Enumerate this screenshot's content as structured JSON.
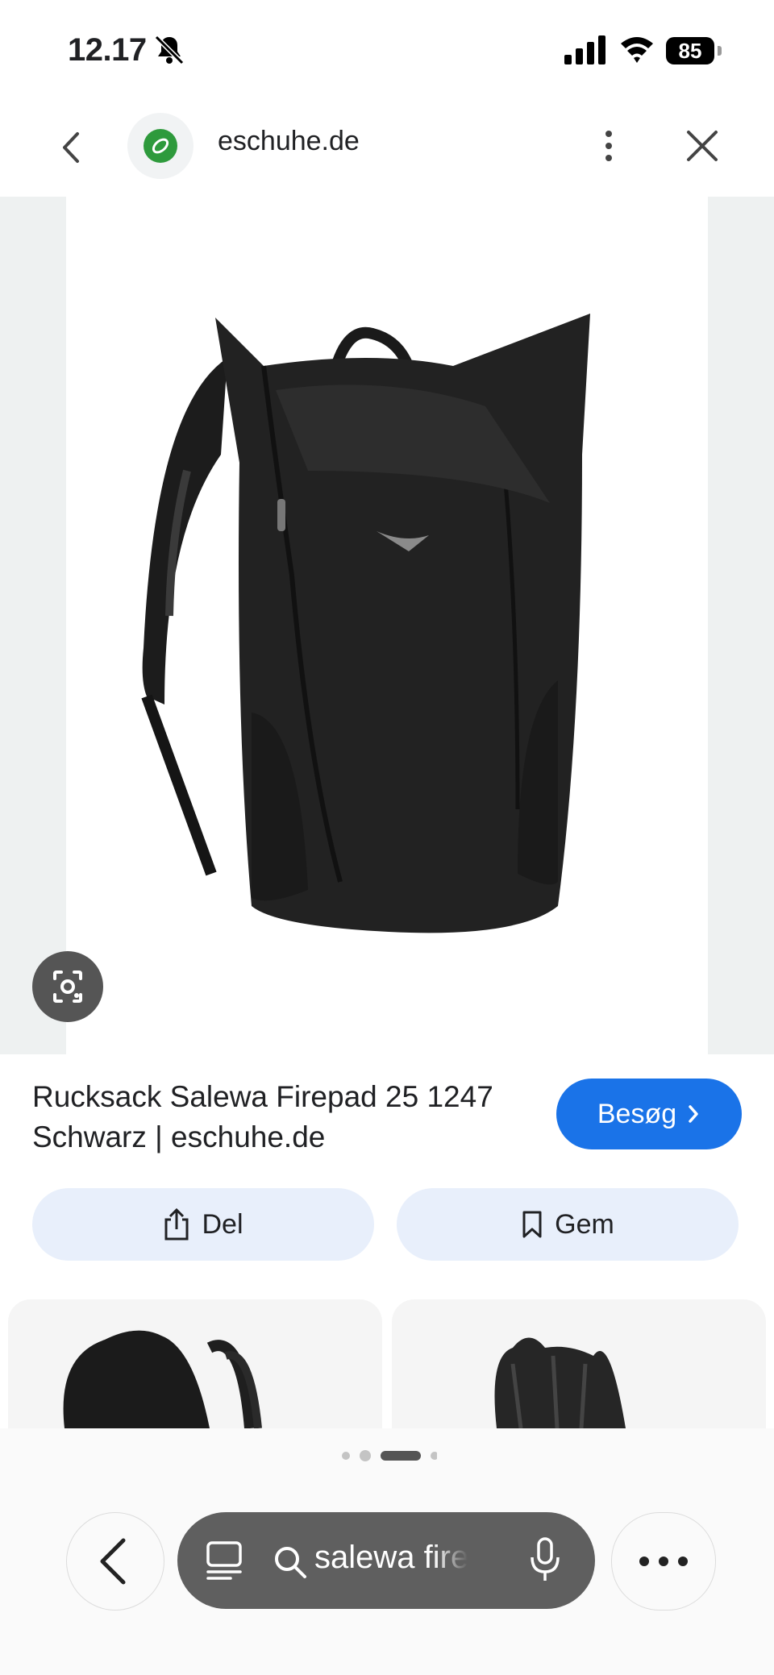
{
  "status_bar": {
    "time": "12.17",
    "battery": "85"
  },
  "header": {
    "site_name": "eschuhe.de"
  },
  "result": {
    "title": "Rucksack Salewa Firepad 25 1247 Schwarz | eschuhe.de",
    "visit_label": "Besøg",
    "share_label": "Del",
    "save_label": "Gem"
  },
  "bottom_bar": {
    "search_text": "salewa firepad"
  },
  "pager": {
    "count": 4,
    "active": 2
  },
  "colors": {
    "accent": "#1a73e8",
    "pill": "#e8effb",
    "search_bg": "#5f5f5f",
    "logo_green": "#2e9a3c"
  },
  "icons": [
    "bell-slash-icon",
    "signal-icon",
    "wifi-icon",
    "battery-icon",
    "back-chevron-icon",
    "site-logo-icon",
    "more-vert-icon",
    "close-icon",
    "lens-icon",
    "share-icon",
    "bookmark-icon",
    "chevron-right-icon",
    "tabs-icon",
    "search-icon",
    "mic-icon",
    "more-horiz-icon"
  ]
}
